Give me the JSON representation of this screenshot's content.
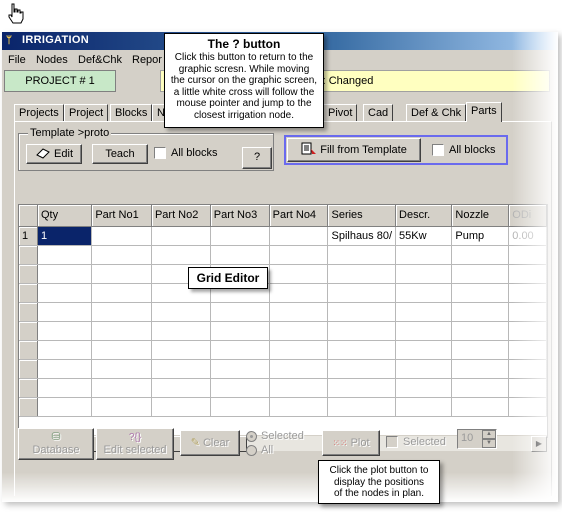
{
  "window": {
    "title": "IRRIGATION"
  },
  "menu": [
    "File",
    "Nodes",
    "Def&Chk",
    "Repor"
  ],
  "project": {
    "label": "PROJECT # 1"
  },
  "status": {
    "text": "ATUS : Changed"
  },
  "tabs": [
    "Projects",
    "Project",
    "Blocks",
    "N",
    "Pivot",
    "Cad",
    "Def & Chk",
    "Parts"
  ],
  "active_tab": "Parts",
  "template_group": {
    "title": "Template >proto",
    "edit_label": "Edit",
    "teach_label": "Teach",
    "all_blocks_label": "All blocks",
    "all_blocks_checked": false
  },
  "help_button": {
    "label": "?"
  },
  "fill_template": {
    "label": "Fill from Template",
    "all_blocks_label": "All blocks",
    "all_blocks_checked": false
  },
  "grid": {
    "columns": [
      "",
      "Qty",
      "Part No1",
      "Part No2",
      "Part No3",
      "Part No4",
      "Series",
      "Descr.",
      "Nozzle",
      "ODi"
    ],
    "rows": [
      [
        "1",
        "1",
        "",
        "",
        "",
        "",
        "Spilhaus 80/",
        "55Kw",
        "Pump",
        "0.00"
      ]
    ],
    "empty_rows": 9
  },
  "bottom": {
    "database_label": "Database",
    "edit_selected_label": "Edit selected",
    "clear_label": "Clear",
    "selected_radio_label": "Selected",
    "all_radio_label": "All",
    "plot_label": "Plot",
    "selected_check_label": "Selected",
    "spin_value": "10"
  },
  "callouts": {
    "help": {
      "title": "The ? button",
      "lines": [
        "Click this button to return to the",
        "graphic scresn. While moving",
        "the cursor on the graphic screen,",
        "a little white cross will follow the",
        "mouse pointer and jump to the",
        "closest irrigation node."
      ]
    },
    "grid_editor": "Grid Editor",
    "plot": {
      "lines": [
        "Click the plot button to",
        "display the positions",
        "of the nodes in plan."
      ]
    }
  },
  "colors": {
    "title_bar": "#0a246a",
    "project_bg": "#c8e8c8",
    "status_bg": "#ffffc0",
    "selection": "#0a246a",
    "fill_border": "#6a6aee"
  }
}
